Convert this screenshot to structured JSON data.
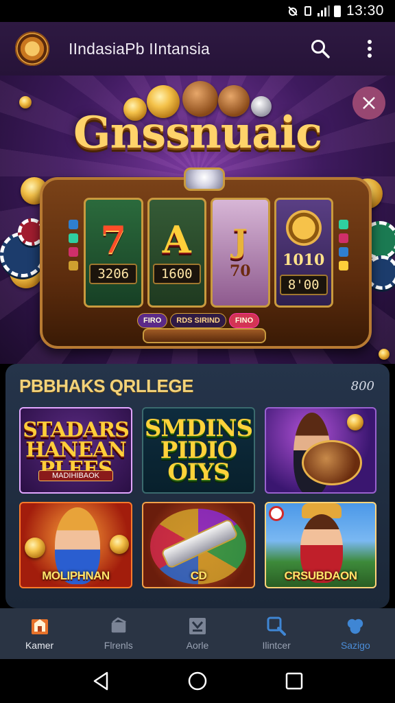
{
  "status_bar": {
    "time": "13:30"
  },
  "app_bar": {
    "title": "IIndasiaPb IIntansia"
  },
  "hero": {
    "title": "Gnssnuaic",
    "reel_heads": [
      "",
      "",
      "",
      ""
    ],
    "reels": [
      {
        "symbol": "7",
        "value": "3206"
      },
      {
        "symbol": "A",
        "value": "1600"
      },
      {
        "symbol": "J",
        "sub": "70"
      },
      {
        "symbol": "coin",
        "sub": "1010",
        "value": "8'00"
      }
    ],
    "buttons": [
      "FIRO",
      "RDS SIRIND",
      "FINO"
    ]
  },
  "featured": {
    "title": "PBBHAKS QRLLEGE",
    "count": "800",
    "games": [
      {
        "title": "STADARS\nHANEAN\nPLEES",
        "sub": "MADIHIBAOK"
      },
      {
        "title": "SMDINS\nPIDIO\nOIYS"
      },
      {
        "title": ""
      },
      {
        "label": "MOLIPHNAN"
      },
      {
        "label": "CD"
      },
      {
        "label": "CRSUBDAON"
      }
    ]
  },
  "bottom_nav": [
    {
      "label": "Kamer",
      "icon": "game-home-icon"
    },
    {
      "label": "Flrenls",
      "icon": "cards-icon"
    },
    {
      "label": "Aorle",
      "icon": "box-icon"
    },
    {
      "label": "Ilintcer",
      "icon": "search-icon"
    },
    {
      "label": "Sazigo",
      "icon": "settings-icon"
    }
  ],
  "colors": {
    "accent_gold": "#f2d27a",
    "nav_active": "#4b8dd8",
    "app_bar": "#2e1942"
  }
}
